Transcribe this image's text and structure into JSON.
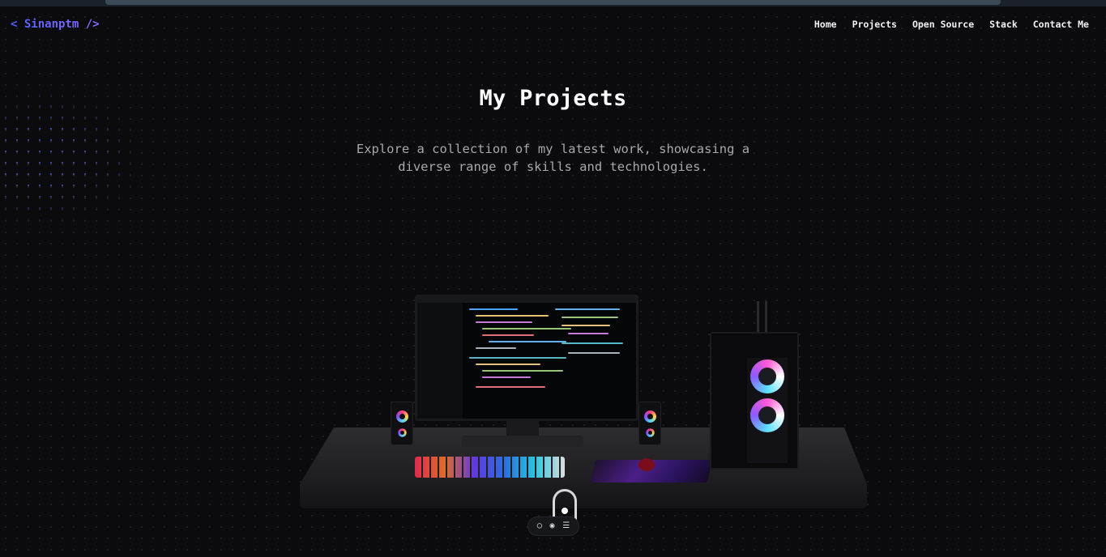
{
  "header": {
    "logo": "< Sinanptm />",
    "nav": [
      "Home",
      "Projects",
      "Open Source",
      "Stack",
      "Contact Me"
    ]
  },
  "hero": {
    "title": "My Projects",
    "subtitle": "Explore a collection of my latest work, showcasing a diverse range of skills and technologies."
  },
  "toolbar": {
    "icons": [
      "chat-icon",
      "eye-icon",
      "list-icon"
    ]
  },
  "colors": {
    "background": "#0b0b0d",
    "logo_accent": "#5b6cff",
    "text": "#ffffff",
    "subtitle": "#a7a7ad"
  }
}
